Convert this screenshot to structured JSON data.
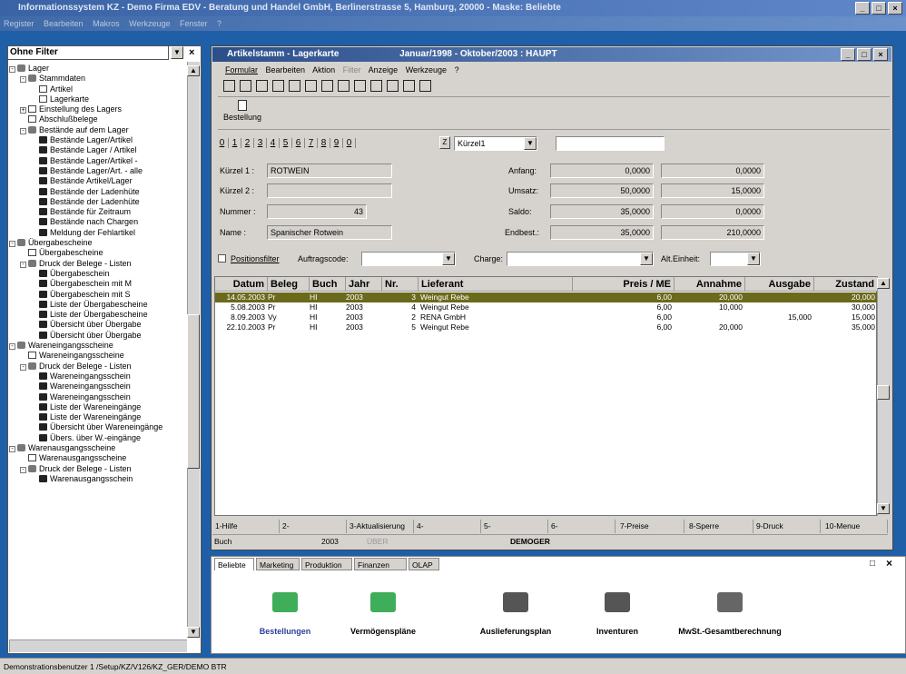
{
  "app": {
    "title": "Informationssystem KZ - Demo Firma EDV - Beratung und Handel GmbH, Berlinerstrasse 5, Hamburg, 20000 - Maske: Beliebte",
    "menu": [
      "Register",
      "Bearbeiten",
      "Makros",
      "Werkzeuge",
      "Fenster",
      "?"
    ]
  },
  "sidebar": {
    "filter": "Ohne Filter",
    "tree": [
      {
        "label": "Lager",
        "indent": 0,
        "icon": "folder-icon",
        "pm": "-"
      },
      {
        "label": "Stammdaten",
        "indent": 1,
        "icon": "folder-icon",
        "pm": "-"
      },
      {
        "label": "Artikel",
        "indent": 2,
        "icon": "document-icon",
        "pm": ""
      },
      {
        "label": "Lagerkarte",
        "indent": 2,
        "icon": "document-icon",
        "pm": ""
      },
      {
        "label": "Einstellung des Lagers",
        "indent": 1,
        "icon": "document-icon",
        "pm": "+"
      },
      {
        "label": "Abschlußbelege",
        "indent": 1,
        "icon": "book-icon",
        "pm": ""
      },
      {
        "label": "Bestände auf dem Lager",
        "indent": 1,
        "icon": "folder-icon",
        "pm": "-"
      },
      {
        "label": "Bestände Lager/Artikel",
        "indent": 2,
        "icon": "printer-icon",
        "pm": ""
      },
      {
        "label": "Bestände Lager / Artikel",
        "indent": 2,
        "icon": "printer-icon",
        "pm": ""
      },
      {
        "label": "Bestände Lager/Artikel -",
        "indent": 2,
        "icon": "printer-icon",
        "pm": ""
      },
      {
        "label": "Bestände Lager/Art. - alle",
        "indent": 2,
        "icon": "printer-icon",
        "pm": ""
      },
      {
        "label": "Bestände Artikel/Lager",
        "indent": 2,
        "icon": "printer-icon",
        "pm": ""
      },
      {
        "label": "Bestände der Ladenhüte",
        "indent": 2,
        "icon": "printer-icon",
        "pm": ""
      },
      {
        "label": "Bestände der Ladenhüte",
        "indent": 2,
        "icon": "printer-icon",
        "pm": ""
      },
      {
        "label": "Bestände für Zeitraum",
        "indent": 2,
        "icon": "printer-icon",
        "pm": ""
      },
      {
        "label": "Bestände nach Chargen",
        "indent": 2,
        "icon": "printer-icon",
        "pm": ""
      },
      {
        "label": "Meldung der Fehlartikel",
        "indent": 2,
        "icon": "printer-icon",
        "pm": ""
      },
      {
        "label": "Übergabescheine",
        "indent": 0,
        "icon": "folder-icon",
        "pm": "-"
      },
      {
        "label": "Übergabescheine",
        "indent": 1,
        "icon": "book-icon",
        "pm": ""
      },
      {
        "label": "Druck der Belege - Listen",
        "indent": 1,
        "icon": "folder-icon",
        "pm": "-"
      },
      {
        "label": "Übergabeschein",
        "indent": 2,
        "icon": "printer-icon",
        "pm": ""
      },
      {
        "label": "Übergabeschein mit M",
        "indent": 2,
        "icon": "printer-icon",
        "pm": ""
      },
      {
        "label": "Übergabeschein mit S",
        "indent": 2,
        "icon": "printer-icon",
        "pm": ""
      },
      {
        "label": "Liste der Übergabescheine",
        "indent": 2,
        "icon": "printer-icon",
        "pm": ""
      },
      {
        "label": "Liste der Übergabescheine",
        "indent": 2,
        "icon": "printer-icon",
        "pm": ""
      },
      {
        "label": "Übersicht über Übergabe",
        "indent": 2,
        "icon": "printer-icon",
        "pm": ""
      },
      {
        "label": "Übersicht über Übergabe",
        "indent": 2,
        "icon": "printer-icon",
        "pm": ""
      },
      {
        "label": "Wareneingangsscheine",
        "indent": 0,
        "icon": "folder-icon",
        "pm": "-"
      },
      {
        "label": "Wareneingangsscheine",
        "indent": 1,
        "icon": "book-icon",
        "pm": ""
      },
      {
        "label": "Druck der Belege - Listen",
        "indent": 1,
        "icon": "folder-icon",
        "pm": "-"
      },
      {
        "label": "Wareneingangsschein",
        "indent": 2,
        "icon": "printer-icon",
        "pm": ""
      },
      {
        "label": "Wareneingangsschein",
        "indent": 2,
        "icon": "printer-icon",
        "pm": ""
      },
      {
        "label": "Wareneingangsschein",
        "indent": 2,
        "icon": "printer-icon",
        "pm": ""
      },
      {
        "label": "Liste der Wareneingänge",
        "indent": 2,
        "icon": "printer-icon",
        "pm": ""
      },
      {
        "label": "Liste der Wareneingänge",
        "indent": 2,
        "icon": "printer-icon",
        "pm": ""
      },
      {
        "label": "Übersicht über Wareneingänge",
        "indent": 2,
        "icon": "printer-icon",
        "pm": ""
      },
      {
        "label": "Übers. über W.-eingänge",
        "indent": 2,
        "icon": "printer-icon",
        "pm": ""
      },
      {
        "label": "Warenausgangsscheine",
        "indent": 0,
        "icon": "folder-icon",
        "pm": "-"
      },
      {
        "label": "Warenausgangsscheine",
        "indent": 1,
        "icon": "book-icon",
        "pm": ""
      },
      {
        "label": "Druck der Belege - Listen",
        "indent": 1,
        "icon": "folder-icon",
        "pm": "-"
      },
      {
        "label": "Warenausgangsschein",
        "indent": 2,
        "icon": "printer-icon",
        "pm": ""
      }
    ]
  },
  "main": {
    "title": "Artikelstamm - Lagerkarte",
    "period": "Januar/1998 - Oktober/2003 : HAUPT",
    "menu": [
      "Formular",
      "Bearbeiten",
      "Aktion",
      "Filter",
      "Anzeige",
      "Werkzeuge",
      "?"
    ],
    "order_button": "Bestellung",
    "index_tabs": [
      "0",
      "1",
      "2",
      "3",
      "4",
      "5",
      "6",
      "7",
      "8",
      "9",
      "0"
    ],
    "sort_field": "Kürzel1",
    "kuerzel1_label": "Kürzel 1 :",
    "kuerzel1_value": "ROTWEIN",
    "kuerzel2_label": "Kürzel 2 :",
    "nummer_label": "Nummer :",
    "nummer_value": "43",
    "name_label": "Name :",
    "name_value": "Spanischer Rotwein",
    "anfang_label": "Anfang:",
    "anfang_1": "0,0000",
    "anfang_2": "0,0000",
    "umsatz_label": "Umsatz:",
    "umsatz_1": "50,0000",
    "umsatz_2": "15,0000",
    "saldo_label": "Saldo:",
    "saldo_1": "35,0000",
    "saldo_2": "0,0000",
    "endbest_label": "Endbest.:",
    "endbest_1": "35,0000",
    "endbest_2": "210,0000",
    "positionsfilter_label": "Positionsfilter",
    "auftragscode_label": "Auftragscode:",
    "charge_label": "Charge:",
    "alteinheit_label": "Alt.Einheit:"
  },
  "grid": {
    "headers": [
      "Datum",
      "Beleg",
      "Buch",
      "Jahr",
      "Nr.",
      "Lieferant",
      "Preis / ME",
      "Annahme",
      "Ausgabe",
      "Zustand"
    ],
    "rows": [
      [
        "14.05.2003",
        "Pr",
        "HI",
        "2003",
        "3",
        "Weingut Rebe",
        "6,00",
        "20,000",
        "",
        "20,000"
      ],
      [
        "5.08.2003",
        "Pr",
        "HI",
        "2003",
        "4",
        "Weingut Rebe",
        "6,00",
        "10,000",
        "",
        "30,000"
      ],
      [
        "8.09.2003",
        "Vy",
        "HI",
        "2003",
        "2",
        "RENA GmbH",
        "6,00",
        "",
        "15,000",
        "15,000"
      ],
      [
        "22.10.2003",
        "Pr",
        "HI",
        "2003",
        "5",
        "Weingut Rebe",
        "6,00",
        "20,000",
        "",
        "35,000"
      ]
    ]
  },
  "fkeys": [
    "1-Hilfe",
    "2-",
    "3-Aktualisierung",
    "4-",
    "5-",
    "6-",
    "7-Preise",
    "8-Sperre",
    "9-Druck",
    "10-Menue"
  ],
  "infobar": {
    "buch": "Buch",
    "year": "2003",
    "over": "ÜBER",
    "user": "DEMOGER"
  },
  "bottom": {
    "tabs": [
      "Beliebte",
      "Marketing",
      "Produktion",
      "Finanzen",
      "OLAP"
    ],
    "shortcuts": [
      "Bestellungen",
      "Vermögenspläne",
      "Auslieferungsplan",
      "Inventuren",
      "MwSt.-Gesamtberechnung"
    ]
  },
  "status": {
    "text": "Demonstrationsbenutzer 1 /Setup/KZ/V126/KZ_GER/DEMO BTR"
  },
  "colors": {
    "selected_row": "#6b6a1c",
    "titlebar": "#2c4f8a",
    "background": "#1f5fa8"
  }
}
